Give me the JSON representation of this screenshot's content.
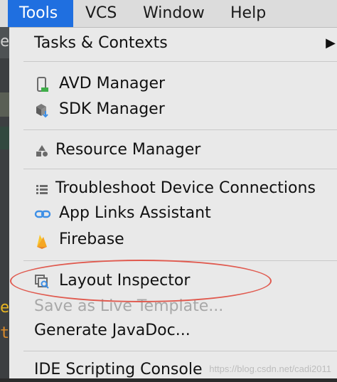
{
  "menubar": {
    "items": [
      "Tools",
      "VCS",
      "Window",
      "Help"
    ],
    "active": "Tools"
  },
  "menu": {
    "tasks": "Tasks & Contexts",
    "avd": "AVD Manager",
    "sdk": "SDK Manager",
    "resource": "Resource Manager",
    "troubleshoot": "Troubleshoot Device Connections",
    "applinks": "App Links Assistant",
    "firebase": "Firebase",
    "layout": "Layout Inspector",
    "save_template": "Save as Live Template...",
    "javadoc": "Generate JavaDoc...",
    "ide_console": "IDE Scripting Console"
  },
  "editor": {
    "chars": [
      "e",
      "e",
      "t"
    ]
  },
  "watermark": "https://blog.csdn.net/cadi2011",
  "colors": {
    "menubar_active": "#1f6fe0",
    "menu_bg": "#e9e9e9",
    "highlight_ring": "#e05a4f",
    "firebase": "#f5a623",
    "link_blue": "#3d8fe6"
  }
}
